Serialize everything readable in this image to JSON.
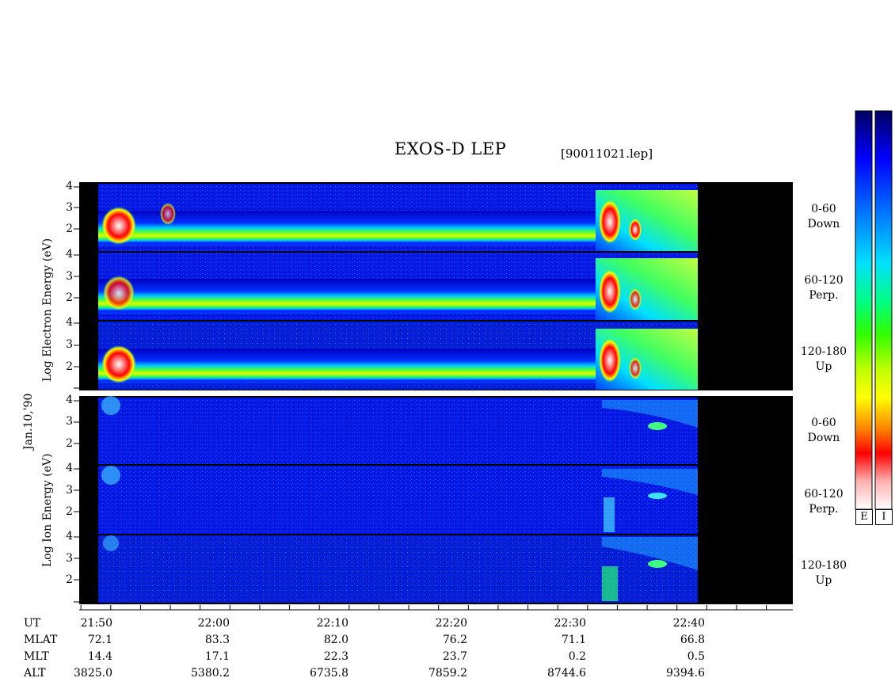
{
  "header": {
    "title": "EXOS-D LEP",
    "filename": "[90011021.lep]"
  },
  "axes": {
    "y_ticks": [
      "4",
      "3",
      "2"
    ],
    "electron_label_lines": [
      "Log",
      "Electron",
      "Energy",
      "(eV)"
    ],
    "ion_label_lines": [
      "Log",
      "Ion",
      "Energy",
      "(eV)"
    ],
    "date_label": "Jan.10,'90"
  },
  "panels": {
    "electron": [
      {
        "pitch": "0-60",
        "dir": "Down"
      },
      {
        "pitch": "60-120",
        "dir": "Perp."
      },
      {
        "pitch": "120-180",
        "dir": "Up"
      }
    ],
    "ion": [
      {
        "pitch": "0-60",
        "dir": "Down"
      },
      {
        "pitch": "60-120",
        "dir": "Perp."
      },
      {
        "pitch": "120-180",
        "dir": "Up"
      }
    ]
  },
  "colorbar": {
    "labels": [
      "E",
      "I"
    ],
    "colors": [
      "#000060",
      "#0000ff",
      "#0070ff",
      "#00e0ff",
      "#00ff80",
      "#30ff00",
      "#c0ff00",
      "#ffff00",
      "#ff8000",
      "#ff0000",
      "#ffb0b0",
      "#ffffff"
    ]
  },
  "footer": {
    "row_labels": [
      "UT",
      "MLAT",
      "MLT",
      "ALT"
    ],
    "columns": [
      {
        "ut": "21:50",
        "mlat": "72.1",
        "mlt": "14.4",
        "alt": "3825.0"
      },
      {
        "ut": "22:00",
        "mlat": "83.3",
        "mlt": "17.1",
        "alt": "5380.2"
      },
      {
        "ut": "22:10",
        "mlat": "82.0",
        "mlt": "22.3",
        "alt": "6735.8"
      },
      {
        "ut": "22:20",
        "mlat": "76.2",
        "mlt": "23.7",
        "alt": "7859.2"
      },
      {
        "ut": "22:30",
        "mlat": "71.1",
        "mlt": "0.2",
        "alt": "8744.6"
      },
      {
        "ut": "22:40",
        "mlat": "66.8",
        "mlt": "0.5",
        "alt": "9394.6"
      }
    ]
  },
  "chart_data": {
    "type": "heatmap",
    "title": "EXOS-D LEP",
    "ylabel": "Log Energy (eV)",
    "ylim": [
      1,
      4
    ],
    "x_ticks_ut": [
      "21:50",
      "22:00",
      "22:10",
      "22:20",
      "22:30",
      "22:40"
    ],
    "x_range_minutes": [
      0,
      58
    ],
    "data_end_minute": 49,
    "electron_band_y": 2.3,
    "events": [
      {
        "start_minute": 0,
        "end_minute": 4,
        "kind": "intense electron burst"
      },
      {
        "start_minute": 5,
        "end_minute": 7,
        "kind": "electron bursts"
      },
      {
        "start_minute": 41,
        "end_minute": 49,
        "kind": "intense electron and ion event"
      }
    ]
  }
}
